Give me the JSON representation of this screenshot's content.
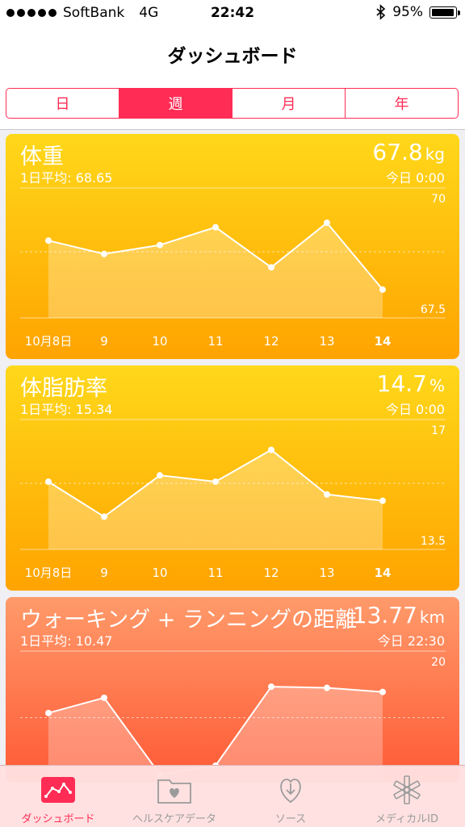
{
  "status": {
    "carrier": "SoftBank",
    "network": "4G",
    "time": "22:42",
    "battery": "95%"
  },
  "nav": {
    "title": "ダッシュボード"
  },
  "segments": [
    {
      "label": "日"
    },
    {
      "label": "週"
    },
    {
      "label": "月"
    },
    {
      "label": "年"
    }
  ],
  "segment_selected": 1,
  "cards": [
    {
      "title": "体重",
      "avg": "1日平均: 68.65",
      "value": "67.8",
      "unit": "kg",
      "time": "今日 0:00",
      "ymax_label": "70",
      "ymin_label": "67.5",
      "x_labels": [
        "10月8日",
        "9",
        "10",
        "11",
        "12",
        "13",
        "14"
      ],
      "values": [
        69.0,
        68.7,
        68.9,
        69.3,
        68.4,
        69.4,
        67.9
      ]
    },
    {
      "title": "体脂肪率",
      "avg": "1日平均: 15.34",
      "value": "14.7",
      "unit": "%",
      "time": "今日 0:00",
      "ymax_label": "17",
      "ymin_label": "13.5",
      "x_labels": [
        "10月8日",
        "9",
        "10",
        "11",
        "12",
        "13",
        "14"
      ],
      "values": [
        15.3,
        14.2,
        15.5,
        15.3,
        16.3,
        14.9,
        14.7
      ]
    },
    {
      "title": "ウォーキング + ランニングの距離",
      "avg": "1日平均: 10.47",
      "value": "13.77",
      "unit": "km",
      "time": "今日 22:30",
      "ymax_label": "20",
      "ymin_label": "",
      "x_labels": [],
      "values": [
        10.8,
        13.4,
        0.3,
        1.8,
        15.3,
        15.1,
        14.4
      ]
    }
  ],
  "chart_data": [
    {
      "type": "line",
      "title": "体重",
      "x": [
        "10月8日",
        "9",
        "10",
        "11",
        "12",
        "13",
        "14"
      ],
      "series": [
        {
          "values": [
            69.0,
            68.7,
            68.9,
            69.3,
            68.4,
            69.4,
            67.9
          ]
        }
      ],
      "ylim": [
        67.5,
        70
      ]
    },
    {
      "type": "line",
      "title": "体脂肪率",
      "x": [
        "10月8日",
        "9",
        "10",
        "11",
        "12",
        "13",
        "14"
      ],
      "series": [
        {
          "values": [
            15.3,
            14.2,
            15.5,
            15.3,
            16.3,
            14.9,
            14.7
          ]
        }
      ],
      "ylim": [
        13.5,
        17
      ]
    },
    {
      "type": "line",
      "title": "ウォーキング + ランニングの距離",
      "series": [
        {
          "values": [
            10.8,
            13.4,
            0.3,
            1.8,
            15.3,
            15.1,
            14.4
          ]
        }
      ],
      "ylim": [
        0,
        20
      ]
    }
  ],
  "tabs": [
    {
      "label": "ダッシュボード",
      "icon": "dashboard-chart-icon"
    },
    {
      "label": "ヘルスケアデータ",
      "icon": "health-data-folder-icon"
    },
    {
      "label": "ソース",
      "icon": "sources-heart-icon"
    },
    {
      "label": "メディカルID",
      "icon": "medical-id-icon"
    }
  ],
  "tab_selected": 0,
  "colors": {
    "accent": "#ff2d55",
    "yellow_top": "#ffd81a",
    "yellow_bottom": "#ffa300",
    "orange_top": "#ff9a6a",
    "orange_bottom": "#ff5a36"
  }
}
